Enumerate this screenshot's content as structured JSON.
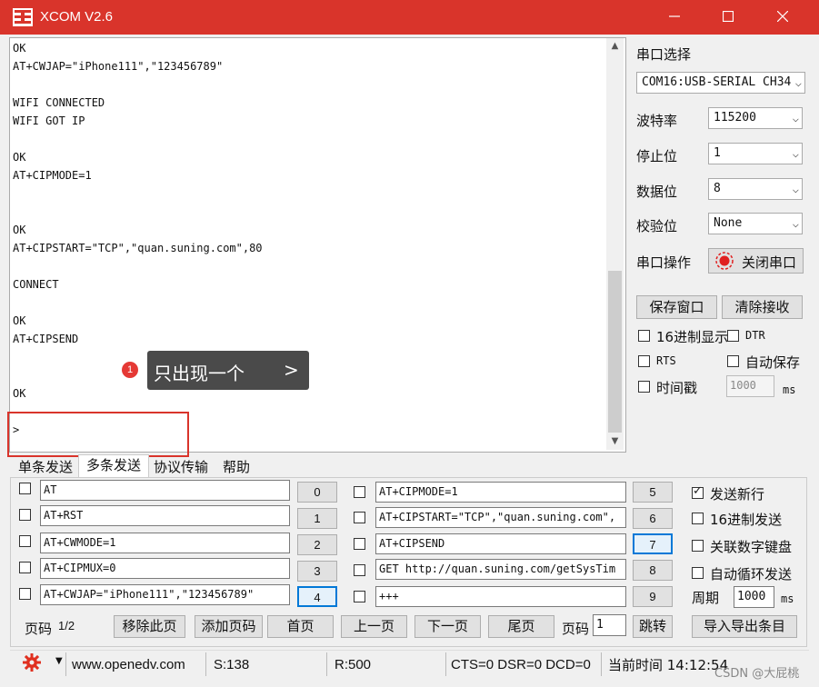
{
  "window": {
    "title": "XCOM V2.6"
  },
  "receive": {
    "lines": [
      "OK",
      "AT+CWJAP=\"iPhone111\",\"123456789\"",
      "",
      "WIFI CONNECTED",
      "WIFI GOT IP",
      "",
      "OK",
      "AT+CIPMODE=1",
      "",
      "",
      "OK",
      "AT+CIPSTART=\"TCP\",\"quan.suning.com\",80",
      "",
      "CONNECT",
      "",
      "OK",
      "AT+CIPSEND",
      "",
      "",
      "OK",
      "",
      ">"
    ]
  },
  "annotation": {
    "badge": "1",
    "text": "只出现一个",
    "chevron": ">"
  },
  "panel": {
    "port_label": "串口选择",
    "port_value": "COM16:USB-SERIAL CH34",
    "baud_label": "波特率",
    "baud_value": "115200",
    "stop_label": "停止位",
    "stop_value": "1",
    "data_label": "数据位",
    "data_value": "8",
    "parity_label": "校验位",
    "parity_value": "None",
    "op_label": "串口操作",
    "op_button": "关闭串口",
    "save_window": "保存窗口",
    "clear_recv": "清除接收",
    "hex_display": "16进制显示",
    "dtr": "DTR",
    "rts": "RTS",
    "auto_save": "自动保存",
    "timestamp": "时间戳",
    "timestamp_value": "1000",
    "timestamp_unit": "ms"
  },
  "tabs": [
    "单条发送",
    "多条发送",
    "协议传输",
    "帮助"
  ],
  "multi": {
    "left_rows": [
      {
        "text": "AT",
        "num": "0"
      },
      {
        "text": "AT+RST",
        "num": "1"
      },
      {
        "text": "AT+CWMODE=1",
        "num": "2"
      },
      {
        "text": "AT+CIPMUX=0",
        "num": "3"
      },
      {
        "text": "AT+CWJAP=\"iPhone111\",\"123456789\"",
        "num": "4"
      }
    ],
    "right_rows": [
      {
        "text": "AT+CIPMODE=1",
        "num": "5"
      },
      {
        "text": "AT+CIPSTART=\"TCP\",\"quan.suning.com\",",
        "num": "6"
      },
      {
        "text": "AT+CIPSEND",
        "num": "7"
      },
      {
        "text": "GET http://quan.suning.com/getSysTim",
        "num": "8"
      },
      {
        "text": "+++",
        "num": "9"
      }
    ],
    "send_newline": "发送新行",
    "hex_send": "16进制发送",
    "link_keypad": "关联数字键盘",
    "auto_loop": "自动循环发送",
    "period_label": "周期",
    "period_value": "1000",
    "period_unit": "ms",
    "page_label": "页码",
    "page_value": "1/2",
    "remove_page": "移除此页",
    "add_page": "添加页码",
    "first_page": "首页",
    "prev_page": "上一页",
    "next_page": "下一页",
    "last_page": "尾页",
    "goto_label": "页码",
    "goto_value": "1",
    "jump": "跳转",
    "import_export": "导入导出条目"
  },
  "status": {
    "url": "www.openedv.com",
    "sent": "S:138",
    "recv": "R:500",
    "lines": "CTS=0 DSR=0 DCD=0",
    "time": "当前时间 14:12:54"
  },
  "watermark": "CSDN @大屁桃",
  "colors": {
    "titlebar": "#d9342b",
    "accent": "#0078d7",
    "record": "#e02020"
  }
}
